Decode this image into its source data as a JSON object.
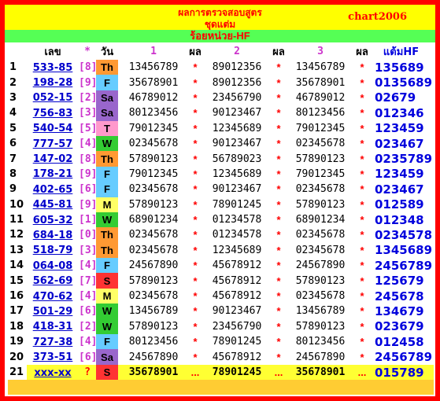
{
  "header": {
    "title_line1": "ผลการตรวจสอบสูตร",
    "title_line2": "ชุดแต่ม",
    "code": "chart2006",
    "subtitle": "ร้อยหน่วย-HF"
  },
  "columns": {
    "lek": "เลข",
    "star": "*",
    "day": "วัน",
    "c1": "1",
    "result1": "ผล",
    "c2": "2",
    "result2": "ผล",
    "c3": "3",
    "result3": "ผล",
    "hf": "แต้มHF"
  },
  "day_colors": {
    "Th": "#ff9933",
    "F": "#66ccff",
    "Sa": "#9966cc",
    "T": "#ff99cc",
    "W": "#33cc33",
    "M": "#ffff66",
    "S": "#ff3333"
  },
  "rows": [
    {
      "n": "1",
      "lek": "533-85",
      "br": "[8]",
      "day": "Th",
      "v1": "13456789",
      "s1": "*",
      "v2": "89012356",
      "s2": "*",
      "v3": "13456789",
      "s3": "*",
      "hf": "135689"
    },
    {
      "n": "2",
      "lek": "198-28",
      "br": "[9]",
      "day": "F",
      "v1": "35678901",
      "s1": "*",
      "v2": "89012356",
      "s2": "*",
      "v3": "35678901",
      "s3": "*",
      "hf": "0135689"
    },
    {
      "n": "3",
      "lek": "052-15",
      "br": "[2]",
      "day": "Sa",
      "v1": "46789012",
      "s1": "*",
      "v2": "23456790",
      "s2": "*",
      "v3": "46789012",
      "s3": "*",
      "hf": "02679"
    },
    {
      "n": "4",
      "lek": "756-83",
      "br": "[3]",
      "day": "Sa",
      "v1": "80123456",
      "s1": "*",
      "v2": "90123467",
      "s2": "*",
      "v3": "80123456",
      "s3": "*",
      "hf": "012346"
    },
    {
      "n": "5",
      "lek": "540-54",
      "br": "[5]",
      "day": "T",
      "v1": "79012345",
      "s1": "*",
      "v2": "12345689",
      "s2": "*",
      "v3": "79012345",
      "s3": "*",
      "hf": "123459"
    },
    {
      "n": "6",
      "lek": "777-57",
      "br": "[4]",
      "day": "W",
      "v1": "02345678",
      "s1": "*",
      "v2": "90123467",
      "s2": "*",
      "v3": "02345678",
      "s3": "*",
      "hf": "023467"
    },
    {
      "n": "7",
      "lek": "147-02",
      "br": "[8]",
      "day": "Th",
      "v1": "57890123",
      "s1": "*",
      "v2": "56789023",
      "s2": "*",
      "v3": "57890123",
      "s3": "*",
      "hf": "0235789"
    },
    {
      "n": "8",
      "lek": "178-21",
      "br": "[9]",
      "day": "F",
      "v1": "79012345",
      "s1": "*",
      "v2": "12345689",
      "s2": "*",
      "v3": "79012345",
      "s3": "*",
      "hf": "123459"
    },
    {
      "n": "9",
      "lek": "402-65",
      "br": "[6]",
      "day": "F",
      "v1": "02345678",
      "s1": "*",
      "v2": "90123467",
      "s2": "*",
      "v3": "02345678",
      "s3": "*",
      "hf": "023467"
    },
    {
      "n": "10",
      "lek": "445-81",
      "br": "[9]",
      "day": "M",
      "v1": "57890123",
      "s1": "*",
      "v2": "78901245",
      "s2": "*",
      "v3": "57890123",
      "s3": "*",
      "hf": "012589"
    },
    {
      "n": "11",
      "lek": "605-32",
      "br": "[1]",
      "day": "W",
      "v1": "68901234",
      "s1": "*",
      "v2": "01234578",
      "s2": "*",
      "v3": "68901234",
      "s3": "*",
      "hf": "012348"
    },
    {
      "n": "12",
      "lek": "684-18",
      "br": "[0]",
      "day": "Th",
      "v1": "02345678",
      "s1": "*",
      "v2": "01234578",
      "s2": "*",
      "v3": "02345678",
      "s3": "*",
      "hf": "0234578"
    },
    {
      "n": "13",
      "lek": "518-79",
      "br": "[3]",
      "day": "Th",
      "v1": "02345678",
      "s1": "*",
      "v2": "12345689",
      "s2": "*",
      "v3": "02345678",
      "s3": "*",
      "hf": "1345689"
    },
    {
      "n": "14",
      "lek": "064-08",
      "br": "[4]",
      "day": "F",
      "v1": "24567890",
      "s1": "*",
      "v2": "45678912",
      "s2": "*",
      "v3": "24567890",
      "s3": "*",
      "hf": "2456789"
    },
    {
      "n": "15",
      "lek": "562-69",
      "br": "[7]",
      "day": "S",
      "v1": "57890123",
      "s1": "*",
      "v2": "45678912",
      "s2": "*",
      "v3": "57890123",
      "s3": "*",
      "hf": "125679"
    },
    {
      "n": "16",
      "lek": "470-62",
      "br": "[4]",
      "day": "M",
      "v1": "02345678",
      "s1": "*",
      "v2": "45678912",
      "s2": "*",
      "v3": "02345678",
      "s3": "*",
      "hf": "245678"
    },
    {
      "n": "17",
      "lek": "501-29",
      "br": "[6]",
      "day": "W",
      "v1": "13456789",
      "s1": "*",
      "v2": "90123467",
      "s2": "*",
      "v3": "13456789",
      "s3": "*",
      "hf": "134679"
    },
    {
      "n": "18",
      "lek": "418-31",
      "br": "[2]",
      "day": "W",
      "v1": "57890123",
      "s1": "*",
      "v2": "23456790",
      "s2": "*",
      "v3": "57890123",
      "s3": "*",
      "hf": "023679"
    },
    {
      "n": "19",
      "lek": "727-38",
      "br": "[4]",
      "day": "F",
      "v1": "80123456",
      "s1": "*",
      "v2": "78901245",
      "s2": "*",
      "v3": "80123456",
      "s3": "*",
      "hf": "012458"
    },
    {
      "n": "20",
      "lek": "373-51",
      "br": "[6]",
      "day": "Sa",
      "v1": "24567890",
      "s1": "*",
      "v2": "45678912",
      "s2": "*",
      "v3": "24567890",
      "s3": "*",
      "hf": "2456789"
    },
    {
      "n": "21",
      "lek": "xxx-xx",
      "br": "?",
      "day": "S",
      "v1": "35678901",
      "s1": "...",
      "v2": "78901245",
      "s2": "...",
      "v3": "35678901",
      "s3": "...",
      "hf": "015789"
    }
  ]
}
